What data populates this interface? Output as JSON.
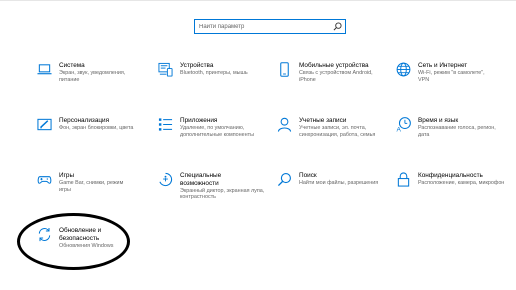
{
  "search": {
    "placeholder": "Найти параметр",
    "icon": "search-icon"
  },
  "tiles": [
    {
      "title": "Система",
      "desc": "Экран, звук, уведомления, питание",
      "icon": "laptop-icon"
    },
    {
      "title": "Устройства",
      "desc": "Bluetooth, принтеры, мышь",
      "icon": "devices-icon"
    },
    {
      "title": "Мобильные устройства",
      "desc": "Связь с устройством Android, iPhone",
      "icon": "phone-icon"
    },
    {
      "title": "Сеть и Интернет",
      "desc": "Wi-Fi, режим \"в самолете\", VPN",
      "icon": "globe-icon"
    },
    {
      "title": "Персонализация",
      "desc": "Фон, экран блокировки, цвета",
      "icon": "personalization-icon"
    },
    {
      "title": "Приложения",
      "desc": "Удаление, по умолчанию, дополнительные компоненты",
      "icon": "apps-icon"
    },
    {
      "title": "Учетные записи",
      "desc": "Учетные записи, эл. почта, синхронизация, работа, семья",
      "icon": "person-icon"
    },
    {
      "title": "Время и язык",
      "desc": "Распознавание голоса, регион, дата",
      "icon": "time-language-icon"
    },
    {
      "title": "Игры",
      "desc": "Game Bar, снимки, режим игры",
      "icon": "gamepad-icon"
    },
    {
      "title": "Специальные возможности",
      "desc": "Экранный диктор, экранная лупа, контрастность",
      "icon": "accessibility-icon"
    },
    {
      "title": "Поиск",
      "desc": "Найти мои файлы, разрешения",
      "icon": "search-icon"
    },
    {
      "title": "Конфиденциальность",
      "desc": "Расположение, камера, микрофон",
      "icon": "lock-icon"
    },
    {
      "title": "Обновление и безопасность",
      "desc": "Обновления Windows",
      "icon": "update-icon"
    }
  ],
  "tile_lines": [
    {
      "t": [
        "Система"
      ],
      "d": [
        "Экран, звук, уведомления,",
        "питание"
      ]
    },
    {
      "t": [
        "Устройства"
      ],
      "d": [
        "Bluetooth, принтеры, мышь"
      ]
    },
    {
      "t": [
        "Мобильные устройства"
      ],
      "d": [
        "Связь с устройством Android,",
        "iPhone"
      ]
    },
    {
      "t": [
        "Сеть и Интернет"
      ],
      "d": [
        "Wi-Fi, режим \"в самолете\",",
        "VPN"
      ]
    },
    {
      "t": [
        "Персонализация"
      ],
      "d": [
        "Фон, экран блокировки, цвета"
      ]
    },
    {
      "t": [
        "Приложения"
      ],
      "d": [
        "Удаление, по умолчанию,",
        "дополнительные компоненты"
      ]
    },
    {
      "t": [
        "Учетные записи"
      ],
      "d": [
        "Учетные записи, эл. почта,",
        "синхронизация, работа, семья"
      ]
    },
    {
      "t": [
        "Время и язык"
      ],
      "d": [
        "Распознавание голоса, регион,",
        "дата"
      ]
    },
    {
      "t": [
        "Игры"
      ],
      "d": [
        "Game Bar, снимки, режим",
        "игры"
      ]
    },
    {
      "t": [
        "Специальные",
        "возможности"
      ],
      "d": [
        "Экранный диктор, экранная лупа,",
        "контрастность"
      ]
    },
    {
      "t": [
        "Поиск"
      ],
      "d": [
        "Найти мои файлы, разрешения"
      ]
    },
    {
      "t": [
        "Конфиденциальность"
      ],
      "d": [
        "Расположение, камера, микрофон"
      ]
    },
    {
      "t": [
        "Обновление и",
        "безопасность"
      ],
      "d": [
        "Обновления Windows"
      ]
    }
  ],
  "colors": {
    "accent": "#0078d7",
    "text": "#000000",
    "secondary_text": "#666666",
    "annotation": "#000000"
  }
}
